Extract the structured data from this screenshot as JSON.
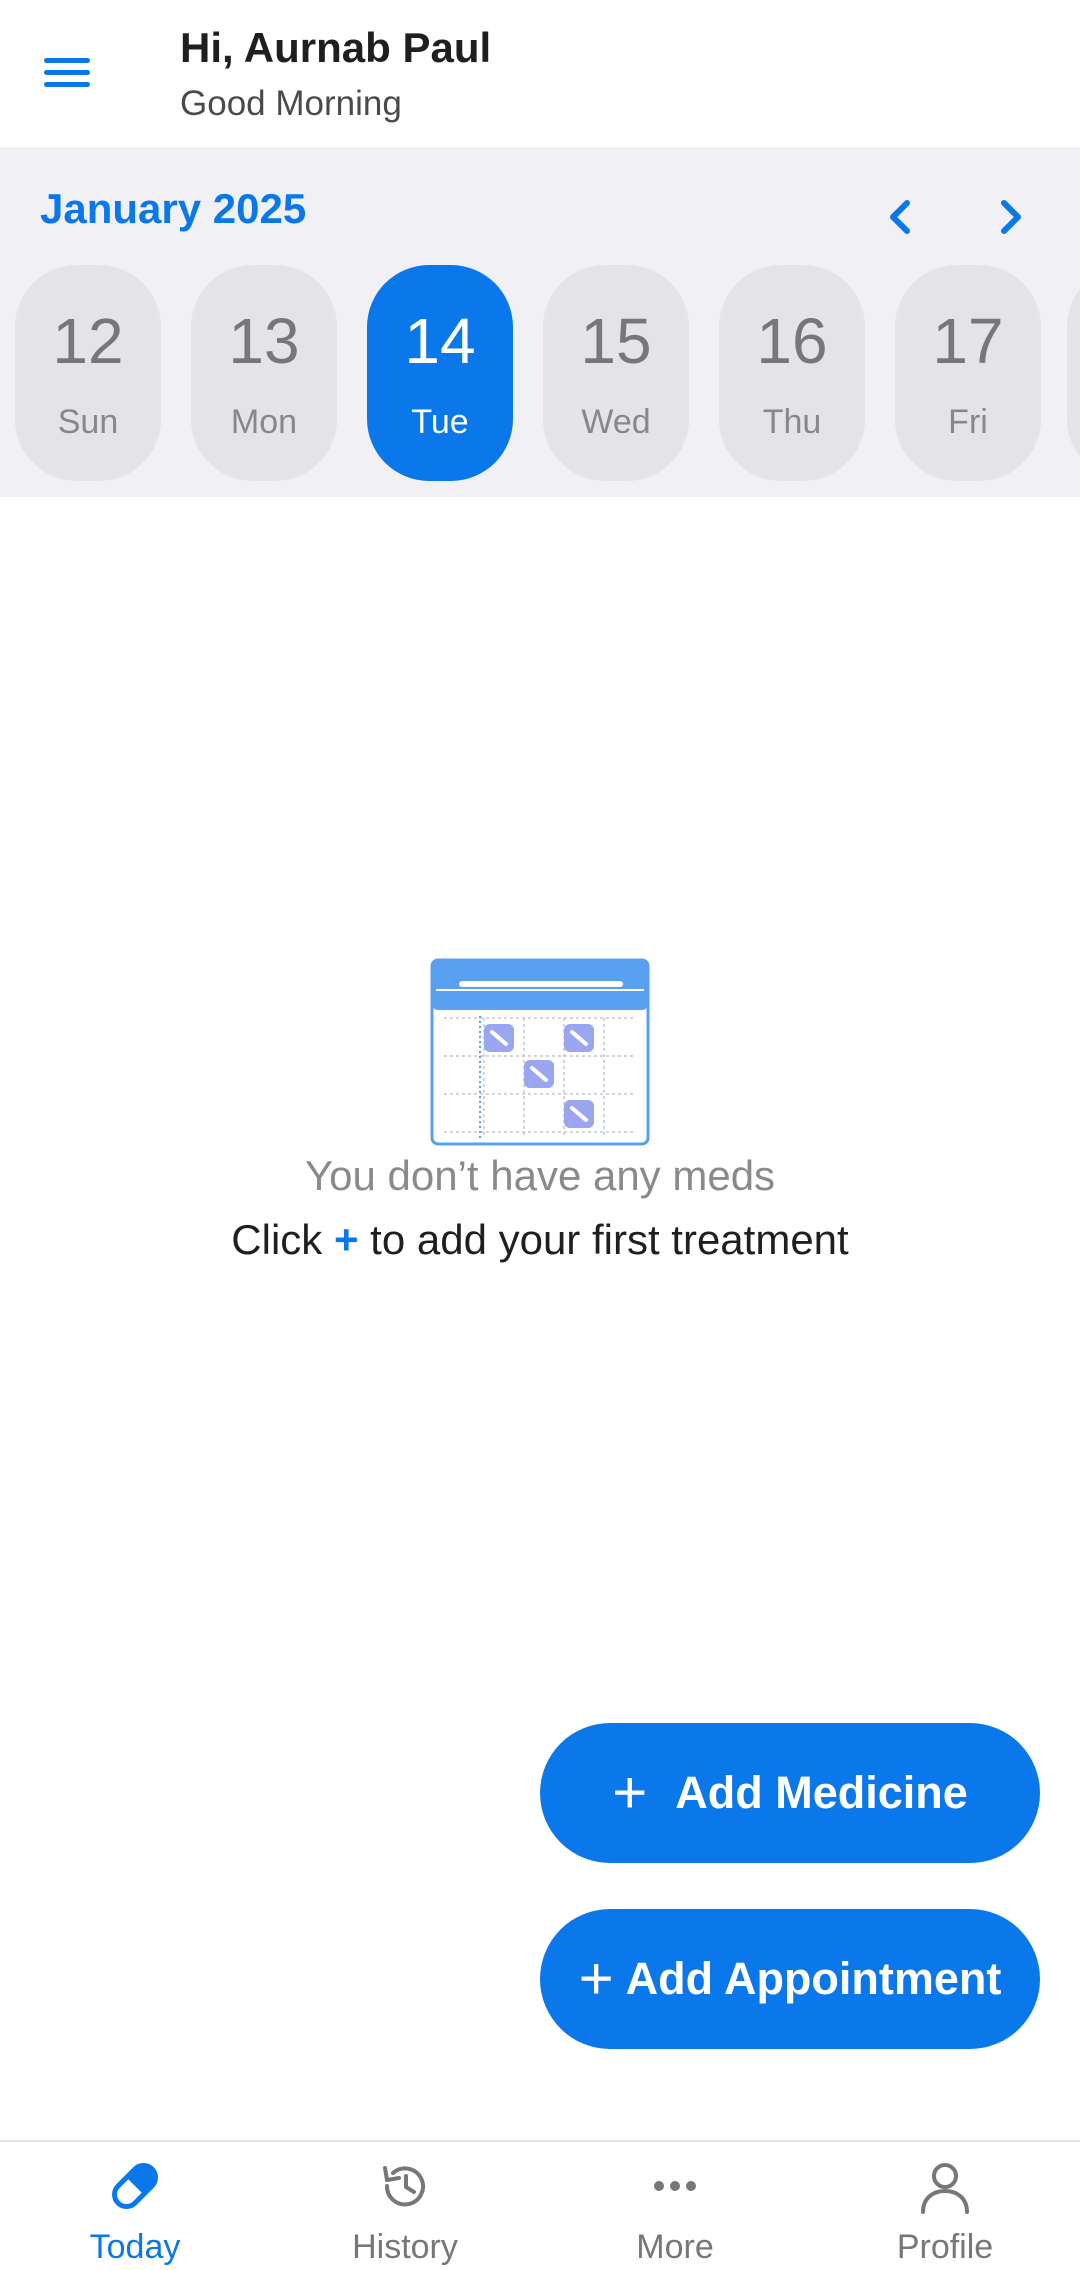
{
  "header": {
    "greeting": "Hi, Aurnab Paul",
    "subgreeting": "Good Morning",
    "menu_icon": "hamburger-menu-icon"
  },
  "calendar": {
    "month_label": "January 2025",
    "prev_icon": "chevron-left-icon",
    "next_icon": "chevron-right-icon",
    "days": [
      {
        "num": "12",
        "dow": "Sun",
        "selected": false
      },
      {
        "num": "13",
        "dow": "Mon",
        "selected": false
      },
      {
        "num": "14",
        "dow": "Tue",
        "selected": true
      },
      {
        "num": "15",
        "dow": "Wed",
        "selected": false
      },
      {
        "num": "16",
        "dow": "Thu",
        "selected": false
      },
      {
        "num": "17",
        "dow": "Fri",
        "selected": false
      }
    ]
  },
  "empty_state": {
    "title": "You don’t have any meds",
    "hint_before": "Click ",
    "hint_plus": "+",
    "hint_after": " to add your first treatment",
    "illustration_icon": "calendar-pills-icon"
  },
  "fabs": {
    "add_medicine": "Add Medicine",
    "add_appointment": "Add Appointment",
    "plus_glyph": "+"
  },
  "bottom_nav": {
    "items": [
      {
        "label": "Today",
        "icon": "pill-icon",
        "active": true
      },
      {
        "label": "History",
        "icon": "history-icon",
        "active": false
      },
      {
        "label": "More",
        "icon": "more-dots-icon",
        "active": false
      },
      {
        "label": "Profile",
        "icon": "profile-icon",
        "active": false
      }
    ]
  },
  "colors": {
    "accent": "#0a78ea",
    "calendar_bg": "#f1f1f5",
    "day_bg": "#e4e4e8"
  }
}
